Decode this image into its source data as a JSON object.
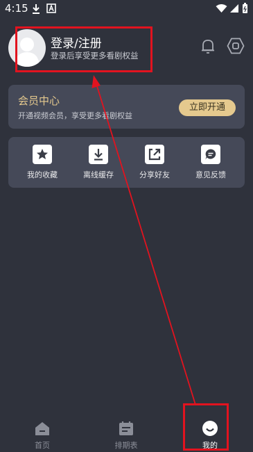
{
  "status_bar": {
    "time": "4:15"
  },
  "profile": {
    "title": "登录/注册",
    "subtitle": "登录后享受更多看剧权益"
  },
  "vip": {
    "title": "会员中心",
    "subtitle": "开通视频会员，享受更多看剧权益",
    "button": "立即开通"
  },
  "actions": [
    {
      "label": "我的收藏",
      "icon": "star-icon"
    },
    {
      "label": "离线缓存",
      "icon": "download-icon"
    },
    {
      "label": "分享好友",
      "icon": "share-icon"
    },
    {
      "label": "意见反馈",
      "icon": "feedback-icon"
    }
  ],
  "tabs": [
    {
      "label": "首页",
      "icon": "home-icon",
      "active": false
    },
    {
      "label": "排期表",
      "icon": "calendar-icon",
      "active": false
    },
    {
      "label": "我的",
      "icon": "smile-icon",
      "active": true
    }
  ],
  "colors": {
    "accent": "#e5c98e",
    "annotation": "#e2131f",
    "background": "#2f323c"
  }
}
